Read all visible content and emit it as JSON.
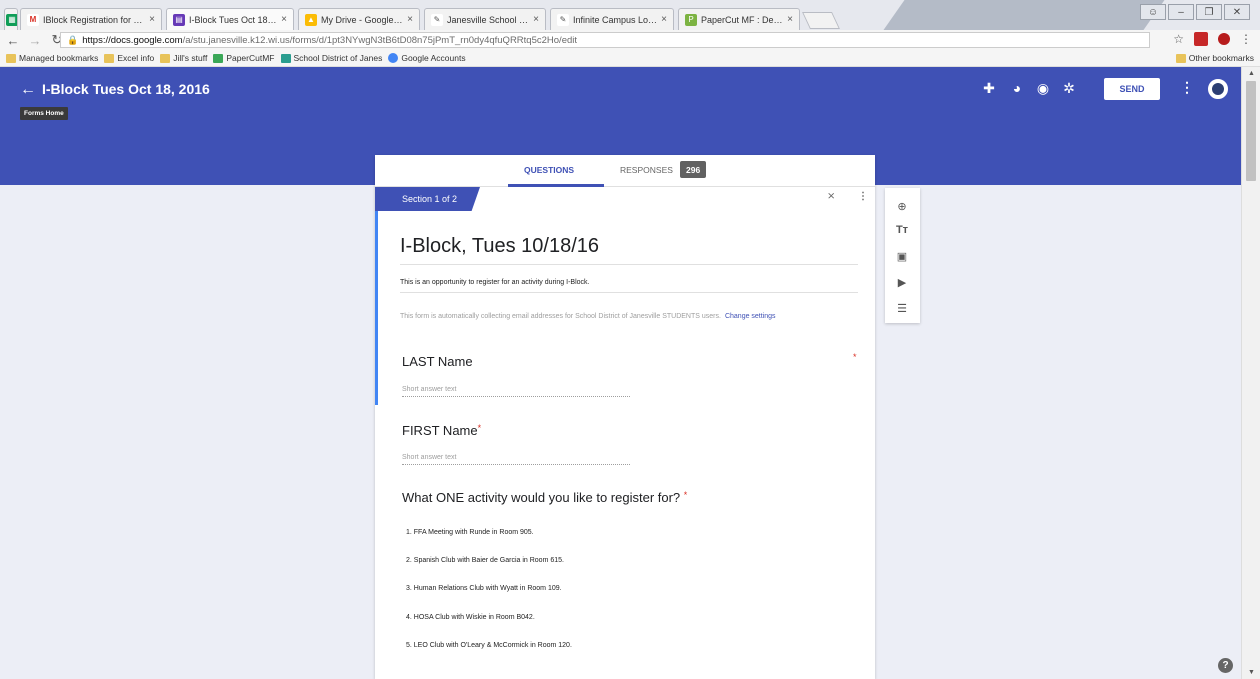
{
  "browser": {
    "tabs": [
      {
        "title": "IBlock Registration for Tue"
      },
      {
        "title": "I-Block Tues Oct 18, 2016"
      },
      {
        "title": "My Drive - Google Drive"
      },
      {
        "title": "Janesville School District K"
      },
      {
        "title": "Infinite Campus Log In Sc"
      },
      {
        "title": "PaperCut MF : Deposit : D"
      }
    ],
    "url_host": "https://docs.google.com",
    "url_path": "/a/stu.janesville.k12.wi.us/forms/d/1pt3NYwgN3tB6tD08n75jPmT_rn0dy4qfuQRRtq5c2Ho/edit",
    "bookmarks": [
      "Managed bookmarks",
      "Excel info",
      "Jill's stuff",
      "PaperCutMF",
      "School District of Janes",
      "Google Accounts"
    ],
    "other_bookmarks": "Other bookmarks"
  },
  "header": {
    "form_title": "I-Block Tues Oct 18, 2016",
    "tooltip": "Forms Home",
    "send_label": "SEND",
    "color": "#3f51b5"
  },
  "tabs": {
    "questions": "QUESTIONS",
    "responses": "RESPONSES",
    "response_count": "296"
  },
  "section": {
    "label": "Section 1 of 2"
  },
  "form": {
    "title": "I-Block, Tues 10/18/16",
    "description": "This is an opportunity to register for an activity during I-Block.",
    "email_notice": "This form is automatically collecting email addresses for School District of Janesville STUDENTS users.",
    "change_settings": "Change settings"
  },
  "questions": [
    {
      "title": "LAST Name",
      "placeholder": "Short answer text"
    },
    {
      "title": "FIRST Name",
      "placeholder": "Short answer text"
    },
    {
      "title": "What ONE activity would you like to register for?"
    }
  ],
  "options": [
    "1.  FFA Meeting with Runde in Room 905.",
    "2.  Spanish Club with Baier de Garcia in Room 615.",
    "3.  Human Relations Club with Wyatt in Room 109.",
    "4.  HOSA Club with Wiskie in Room B042.",
    "5.  LEO Club with O'Leary & McCormick in Room 120."
  ],
  "icons": {
    "header": [
      "puzzle-icon",
      "palette-icon",
      "eye-icon",
      "gear-icon"
    ],
    "tools": [
      "add-circle-icon",
      "title-icon",
      "image-icon",
      "video-icon",
      "section-icon"
    ]
  }
}
